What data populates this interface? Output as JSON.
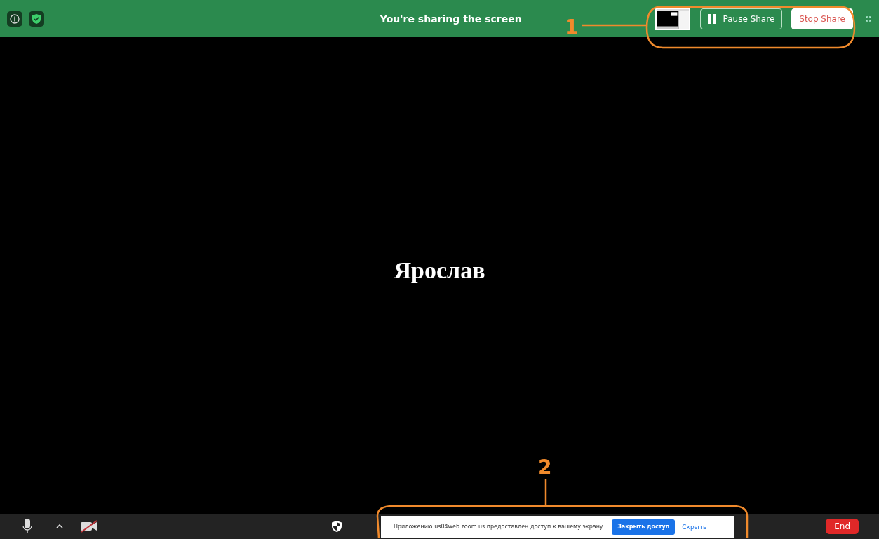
{
  "share_bar": {
    "title": "You're sharing the screen",
    "buttons": [
      {
        "label": "Pause Share",
        "kind": "pause"
      },
      {
        "label": "Stop Share",
        "kind": "stop"
      }
    ]
  },
  "participant": {
    "name": "Ярослав"
  },
  "toolbar": {
    "video_on": false,
    "end_button": "End"
  },
  "notification": {
    "message": "Приложению us04web.zoom.us предоставлен доступ к вашему экрану.",
    "primary_button": "Закрыть доступ",
    "link": "Скрыть"
  },
  "annotations": [
    {
      "label": "1"
    },
    {
      "label": "2"
    }
  ]
}
